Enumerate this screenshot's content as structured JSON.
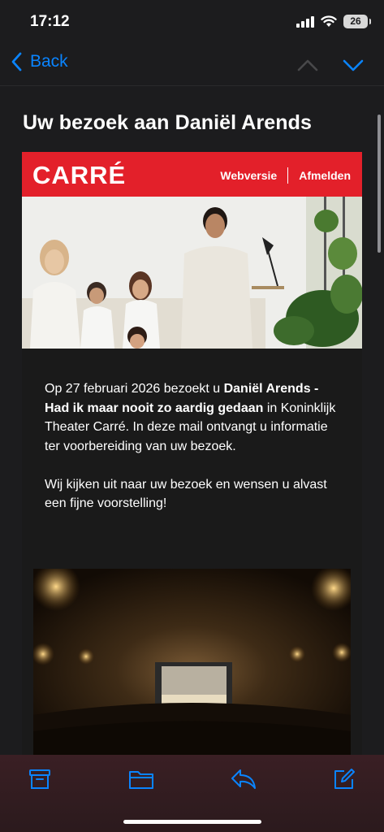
{
  "status_bar": {
    "time": "17:12",
    "battery": "26"
  },
  "nav": {
    "back_label": "Back",
    "up_icon": "chevron-up-icon",
    "down_icon": "chevron-down-icon"
  },
  "email": {
    "subject": "Uw bezoek aan Daniël Arends",
    "header": {
      "logo": "CARRÉ",
      "link_webversie": "Webversie",
      "link_afmelden": "Afmelden",
      "brand_color": "#e3202a"
    },
    "body": {
      "p1_a": "Op 27 februari 2026 bezoekt u ",
      "p1_bold": "Daniël Arends - Had ik maar nooit zo aardig gedaan",
      "p1_b": " in Koninklijk Theater Carré. In deze mail ontvangt u informatie ter voorbereiding van uw bezoek.",
      "p2": "Wij kijken uit naar uw bezoek en wensen u alvast een fijne voorstelling!"
    }
  },
  "toolbar": {
    "icons": [
      "archive-icon",
      "folder-icon",
      "reply-icon",
      "compose-icon"
    ],
    "accent": "#0a84ff"
  }
}
